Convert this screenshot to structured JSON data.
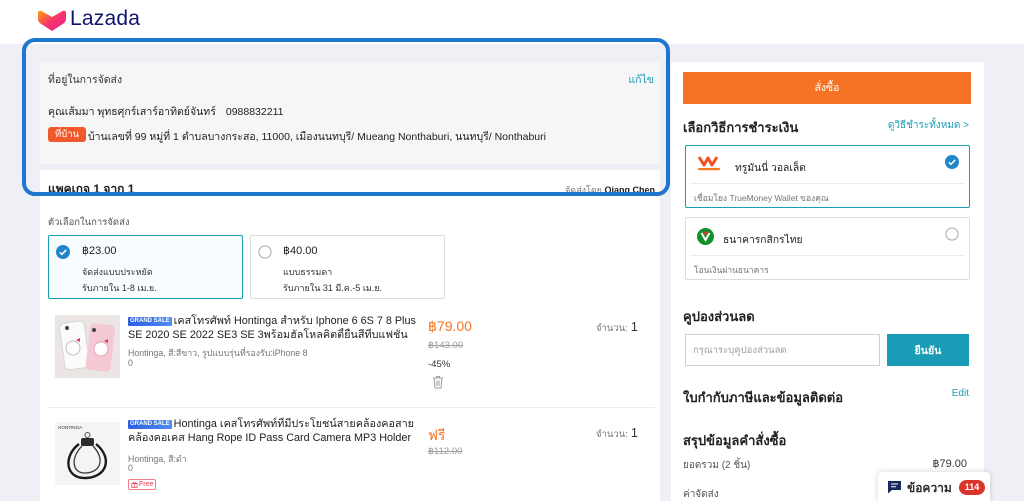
{
  "brand": {
    "name": "Lazada",
    "logo_icon": "lazada-heart-icon"
  },
  "colors": {
    "accent": "#f57224",
    "link": "#1a9cb7",
    "highlight_frame": "#1d77cf",
    "sale_badge": "#2d5fe0",
    "chat_badge": "#d9352c"
  },
  "address": {
    "title": "ที่อยู่ในการจัดส่ง",
    "edit": "แก้ไข",
    "name": "คุณเส้มมา พุทธศุกร์เสาร์อาทิตย์จันทร์",
    "phone": "0988832211",
    "tag": "ที่บ้าน",
    "line": "บ้านเลขที่ 99 หมู่ที่ 1 ตำบลบางกระสอ, 11000, เมืองนนทบุรี/ Mueang Nonthaburi, นนทบุรี/ Nonthaburi"
  },
  "package": {
    "title": "แพคเกจ 1 จาก 1",
    "shipped_by_label": "จัดส่งโดย",
    "seller": "Qiang Chen"
  },
  "shipping": {
    "title": "ตัวเลือกในการจัดส่ง",
    "options": [
      {
        "price": "฿23.00",
        "name": "จัดส่งแบบประหยัด",
        "eta": "รับภายใน 1-8 เม.ย.",
        "selected": true
      },
      {
        "price": "฿40.00",
        "name": "แบบธรรมดา",
        "eta": "รับภายใน 31 มี.ค.-5 เม.ย.",
        "selected": false
      }
    ]
  },
  "items": [
    {
      "badge": "GRAND SALE",
      "title_lines": [
        "เคสโทรศัพท์ Hontinga สำหรับ Iphone 6 6S 7 8 Plus",
        "SE 2020 SE 2022 SE3 SE 3พร้อมฮัลโหลคิตตี้ยื่นสีที่บแฟชั่น"
      ],
      "variant": "Hontinga, สี:สีขาว, รูปแบบรุ่นที่รองรับ:iPhone 8",
      "variant_extra": "0",
      "price": "฿79.00",
      "original_price": "฿143.00",
      "discount": "-45%",
      "qty_label": "จำนวน:",
      "qty": "1",
      "action_icon": "trash-icon"
    },
    {
      "badge": "GRAND SALE",
      "title_lines": [
        "Hontinga เคสโทรศัพท์ที่มีประโยชน์สายคล้องคอสาย",
        "คล้องคอเคส Hang Rope ID Pass Card Camera MP3 Holder"
      ],
      "variant": "Hontinga, สี:ดำ",
      "variant_extra": "0",
      "free_tag": "Free",
      "price": "ฟรี",
      "original_price": "฿112.00",
      "qty_label": "จำนวน:",
      "qty": "1",
      "image_brand": "HONTINGA"
    }
  ],
  "checkout": {
    "order_button": "สั่งซื้อ",
    "payment_title": "เลือกวิธีการชำระเงิน",
    "payment_all": "ดูวิธีชำระทั้งหมด >",
    "payments": [
      {
        "name": "ทรูมันนี่ วอลเล็ต",
        "sub": "เชื่อมโยง TrueMoney Wallet ของคุณ",
        "selected": true,
        "icon": "truemoney-icon"
      },
      {
        "name": "ธนาคารกสิกรไทย",
        "sub": "โอนเงินผ่านธนาคาร",
        "selected": false,
        "icon": "kbank-icon"
      }
    ],
    "coupon_title": "คูปองส่วนลด",
    "coupon_placeholder": "กรุณาระบุคูปองส่วนลด",
    "coupon_button": "ยืนยัน",
    "tax_title": "ใบกำกับภาษีและข้อมูลติดต่อ",
    "tax_edit": "Edit",
    "summary_title": "สรุปข้อมูลคำสั่งซื้อ",
    "subtotal_label": "ยอดรวม (2 ชิ้น)",
    "subtotal_value": "฿79.00",
    "shipping_fee_label": "ค่าจัดส่ง"
  },
  "chat": {
    "label": "ข้อความ",
    "count": "114",
    "icon": "chat-icon"
  }
}
